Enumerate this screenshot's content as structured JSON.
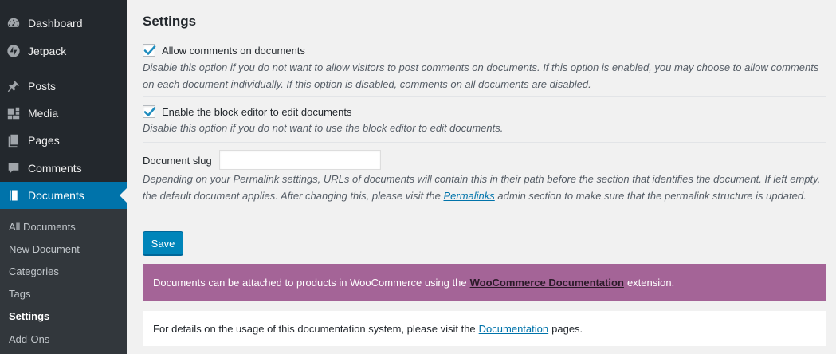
{
  "sidebar": {
    "items": [
      {
        "label": "Dashboard",
        "icon": "dashboard-icon"
      },
      {
        "label": "Jetpack",
        "icon": "jetpack-icon"
      },
      {
        "label": "Posts",
        "icon": "pin-icon"
      },
      {
        "label": "Media",
        "icon": "media-icon"
      },
      {
        "label": "Pages",
        "icon": "pages-icon"
      },
      {
        "label": "Comments",
        "icon": "comment-icon"
      },
      {
        "label": "Documents",
        "icon": "book-icon",
        "current": true
      }
    ],
    "submenu": [
      {
        "label": "All Documents"
      },
      {
        "label": "New Document"
      },
      {
        "label": "Categories"
      },
      {
        "label": "Tags"
      },
      {
        "label": "Settings",
        "active": true
      },
      {
        "label": "Add-Ons"
      }
    ]
  },
  "main": {
    "title": "Settings",
    "comments_option": {
      "checked": true,
      "label": "Allow comments on documents",
      "description": "Disable this option if you do not want to allow visitors to post comments on documents. If this option is enabled, you may choose to allow comments on each document individually. If this option is disabled, comments on all documents are disabled."
    },
    "block_editor_option": {
      "checked": true,
      "label": "Enable the block editor to edit documents",
      "description": "Disable this option if you do not want to use the block editor to edit documents."
    },
    "slug": {
      "label": "Document slug",
      "value": "",
      "description_before": "Depending on your Permalink settings, URLs of documents will contain this in their path before the section that identifies the document. If left empty, the default document applies. After changing this, please visit the",
      "link": "Permalinks",
      "description_after": "admin section to make sure that the permalink structure is updated."
    },
    "save_label": "Save",
    "woo_notice": {
      "before": "Documents can be attached to products in WooCommerce using the",
      "link": "WooCommerce Documentation",
      "after": "extension."
    },
    "docs_notice": {
      "before": "For details on the usage of this documentation system, please visit the",
      "link": "Documentation",
      "after": "pages."
    }
  },
  "colors": {
    "sidebar_bg": "#23282d",
    "submenu_bg": "#32373c",
    "current_menu": "#0073aa",
    "button": "#0085ba",
    "woo_purple": "#a46497",
    "page_bg": "#f1f1f1"
  }
}
